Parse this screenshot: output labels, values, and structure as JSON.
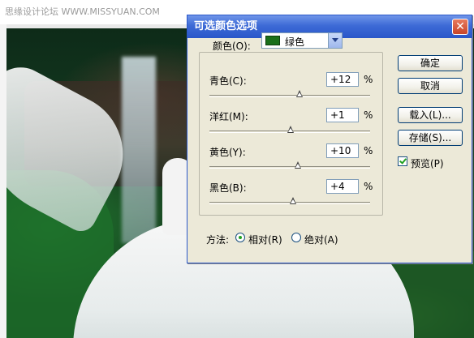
{
  "watermark": "思缘设计论坛  WWW.MISSYUAN.COM",
  "dialog": {
    "title": "可选颜色选项",
    "close_symbol": "✕",
    "colors_label": "颜色(O):",
    "colors_value": "绿色",
    "swatch_color": "#1a6f1a",
    "sliders": [
      {
        "label": "青色(C):",
        "value": "+12",
        "unit": "%",
        "percent": 12
      },
      {
        "label": "洋红(M):",
        "value": "+1",
        "unit": "%",
        "percent": 1
      },
      {
        "label": "黄色(Y):",
        "value": "+10",
        "unit": "%",
        "percent": 10
      },
      {
        "label": "黑色(B):",
        "value": "+4",
        "unit": "%",
        "percent": 4
      }
    ],
    "buttons": {
      "ok": "确定",
      "cancel": "取消",
      "load": "载入(L)...",
      "save": "存储(S)..."
    },
    "preview": {
      "label": "预览(P)",
      "checked": true
    },
    "method": {
      "label": "方法:",
      "relative": "相对(R)",
      "absolute": "绝对(A)",
      "selected": "relative"
    }
  }
}
